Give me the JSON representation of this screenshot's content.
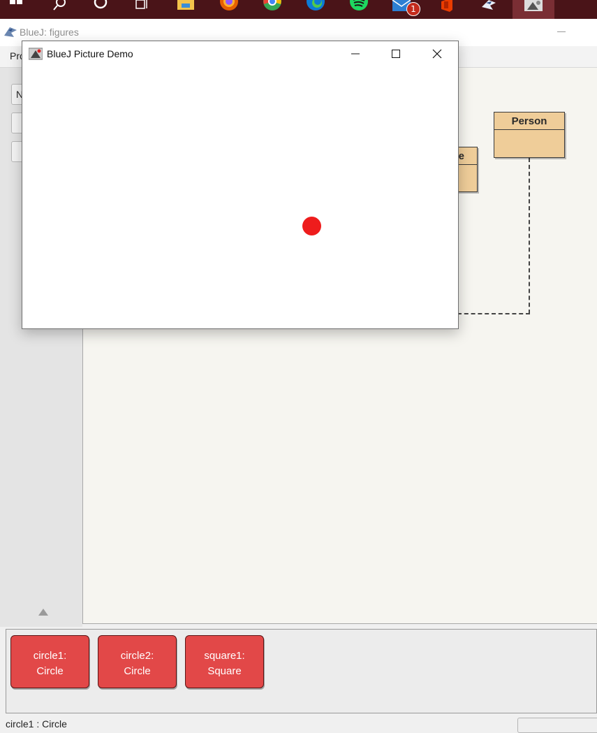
{
  "taskbar": {
    "badge_count": "1",
    "colors": {
      "background": "#4a1418",
      "active": "#7a2e34",
      "badge": "#c42b1c"
    },
    "icons": [
      "windows-start-icon",
      "search-icon",
      "cortana-icon",
      "task-view-icon",
      "file-explorer-icon",
      "firefox-icon",
      "chrome-icon",
      "edge-icon",
      "spotify-icon",
      "mail-icon",
      "office-icon",
      "bluej-icon",
      "picture-demo-icon"
    ]
  },
  "main_window": {
    "title": "BlueJ:  figures",
    "menu_first": "Pro",
    "side_buttons": [
      "N",
      "",
      ""
    ]
  },
  "diagram": {
    "classes": [
      {
        "name": "Person"
      },
      {
        "name": "e"
      }
    ],
    "colors": {
      "class_fill": "#efcd99",
      "background": "#f6f5f0"
    }
  },
  "object_bench": {
    "objects": [
      {
        "line1": "circle1:",
        "line2": "Circle"
      },
      {
        "line1": "circle2:",
        "line2": "Circle"
      },
      {
        "line1": "square1:",
        "line2": "Square"
      }
    ],
    "colors": {
      "object_fill": "#e24848"
    }
  },
  "status": {
    "text": "circle1 : Circle"
  },
  "picture_window": {
    "title": "BlueJ Picture Demo",
    "controls": [
      "minimize-icon",
      "maximize-icon",
      "close-icon"
    ],
    "shapes": [
      {
        "kind": "circle",
        "color": "#ee1c1c"
      }
    ]
  }
}
